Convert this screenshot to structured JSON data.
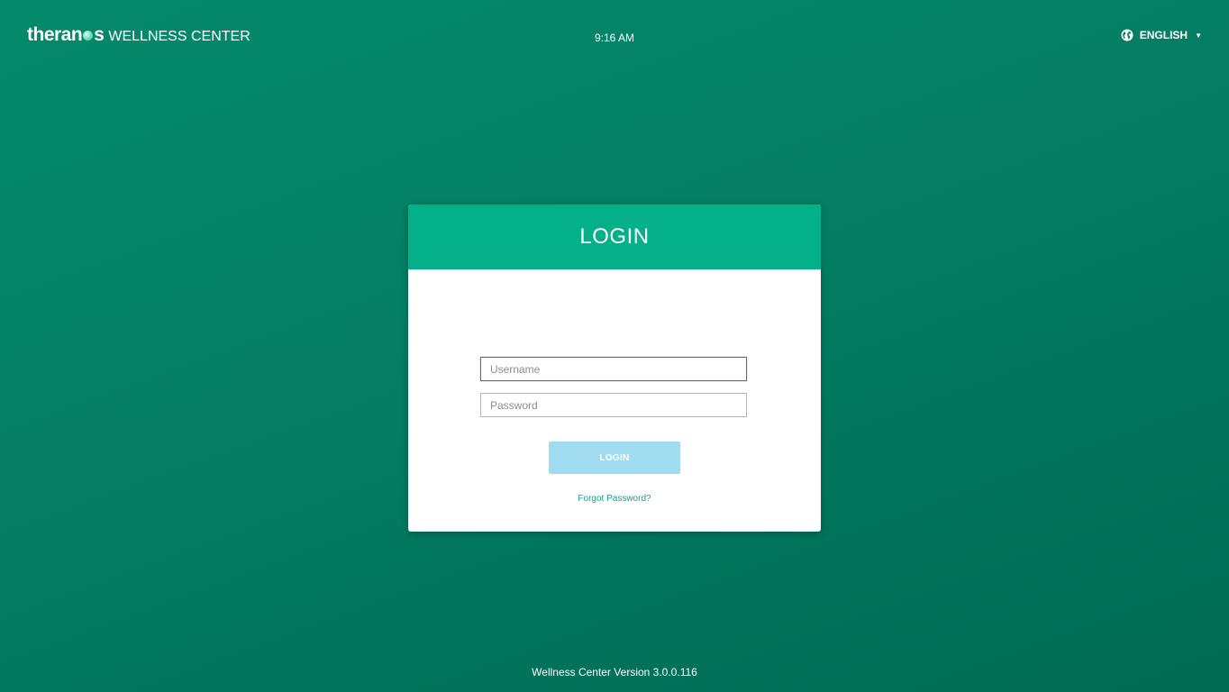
{
  "header": {
    "brand": {
      "part1": "theran",
      "part2": "s",
      "sub": "WELLNESS CENTER"
    },
    "time": "9:16 AM",
    "language": {
      "label": "ENGLISH",
      "icon": "globe-icon",
      "caret": "▼"
    }
  },
  "login": {
    "title": "LOGIN",
    "username_placeholder": "Username",
    "username_value": "",
    "password_placeholder": "Password",
    "password_value": "",
    "button_label": "LOGIN",
    "forgot_label": "Forgot Password?"
  },
  "footer": {
    "version": "Wellness Center Version 3.0.0.116"
  },
  "colors": {
    "background": "#037c62",
    "header_accent": "#03b08a",
    "button_disabled": "#9fdcef",
    "link": "#14a583"
  }
}
